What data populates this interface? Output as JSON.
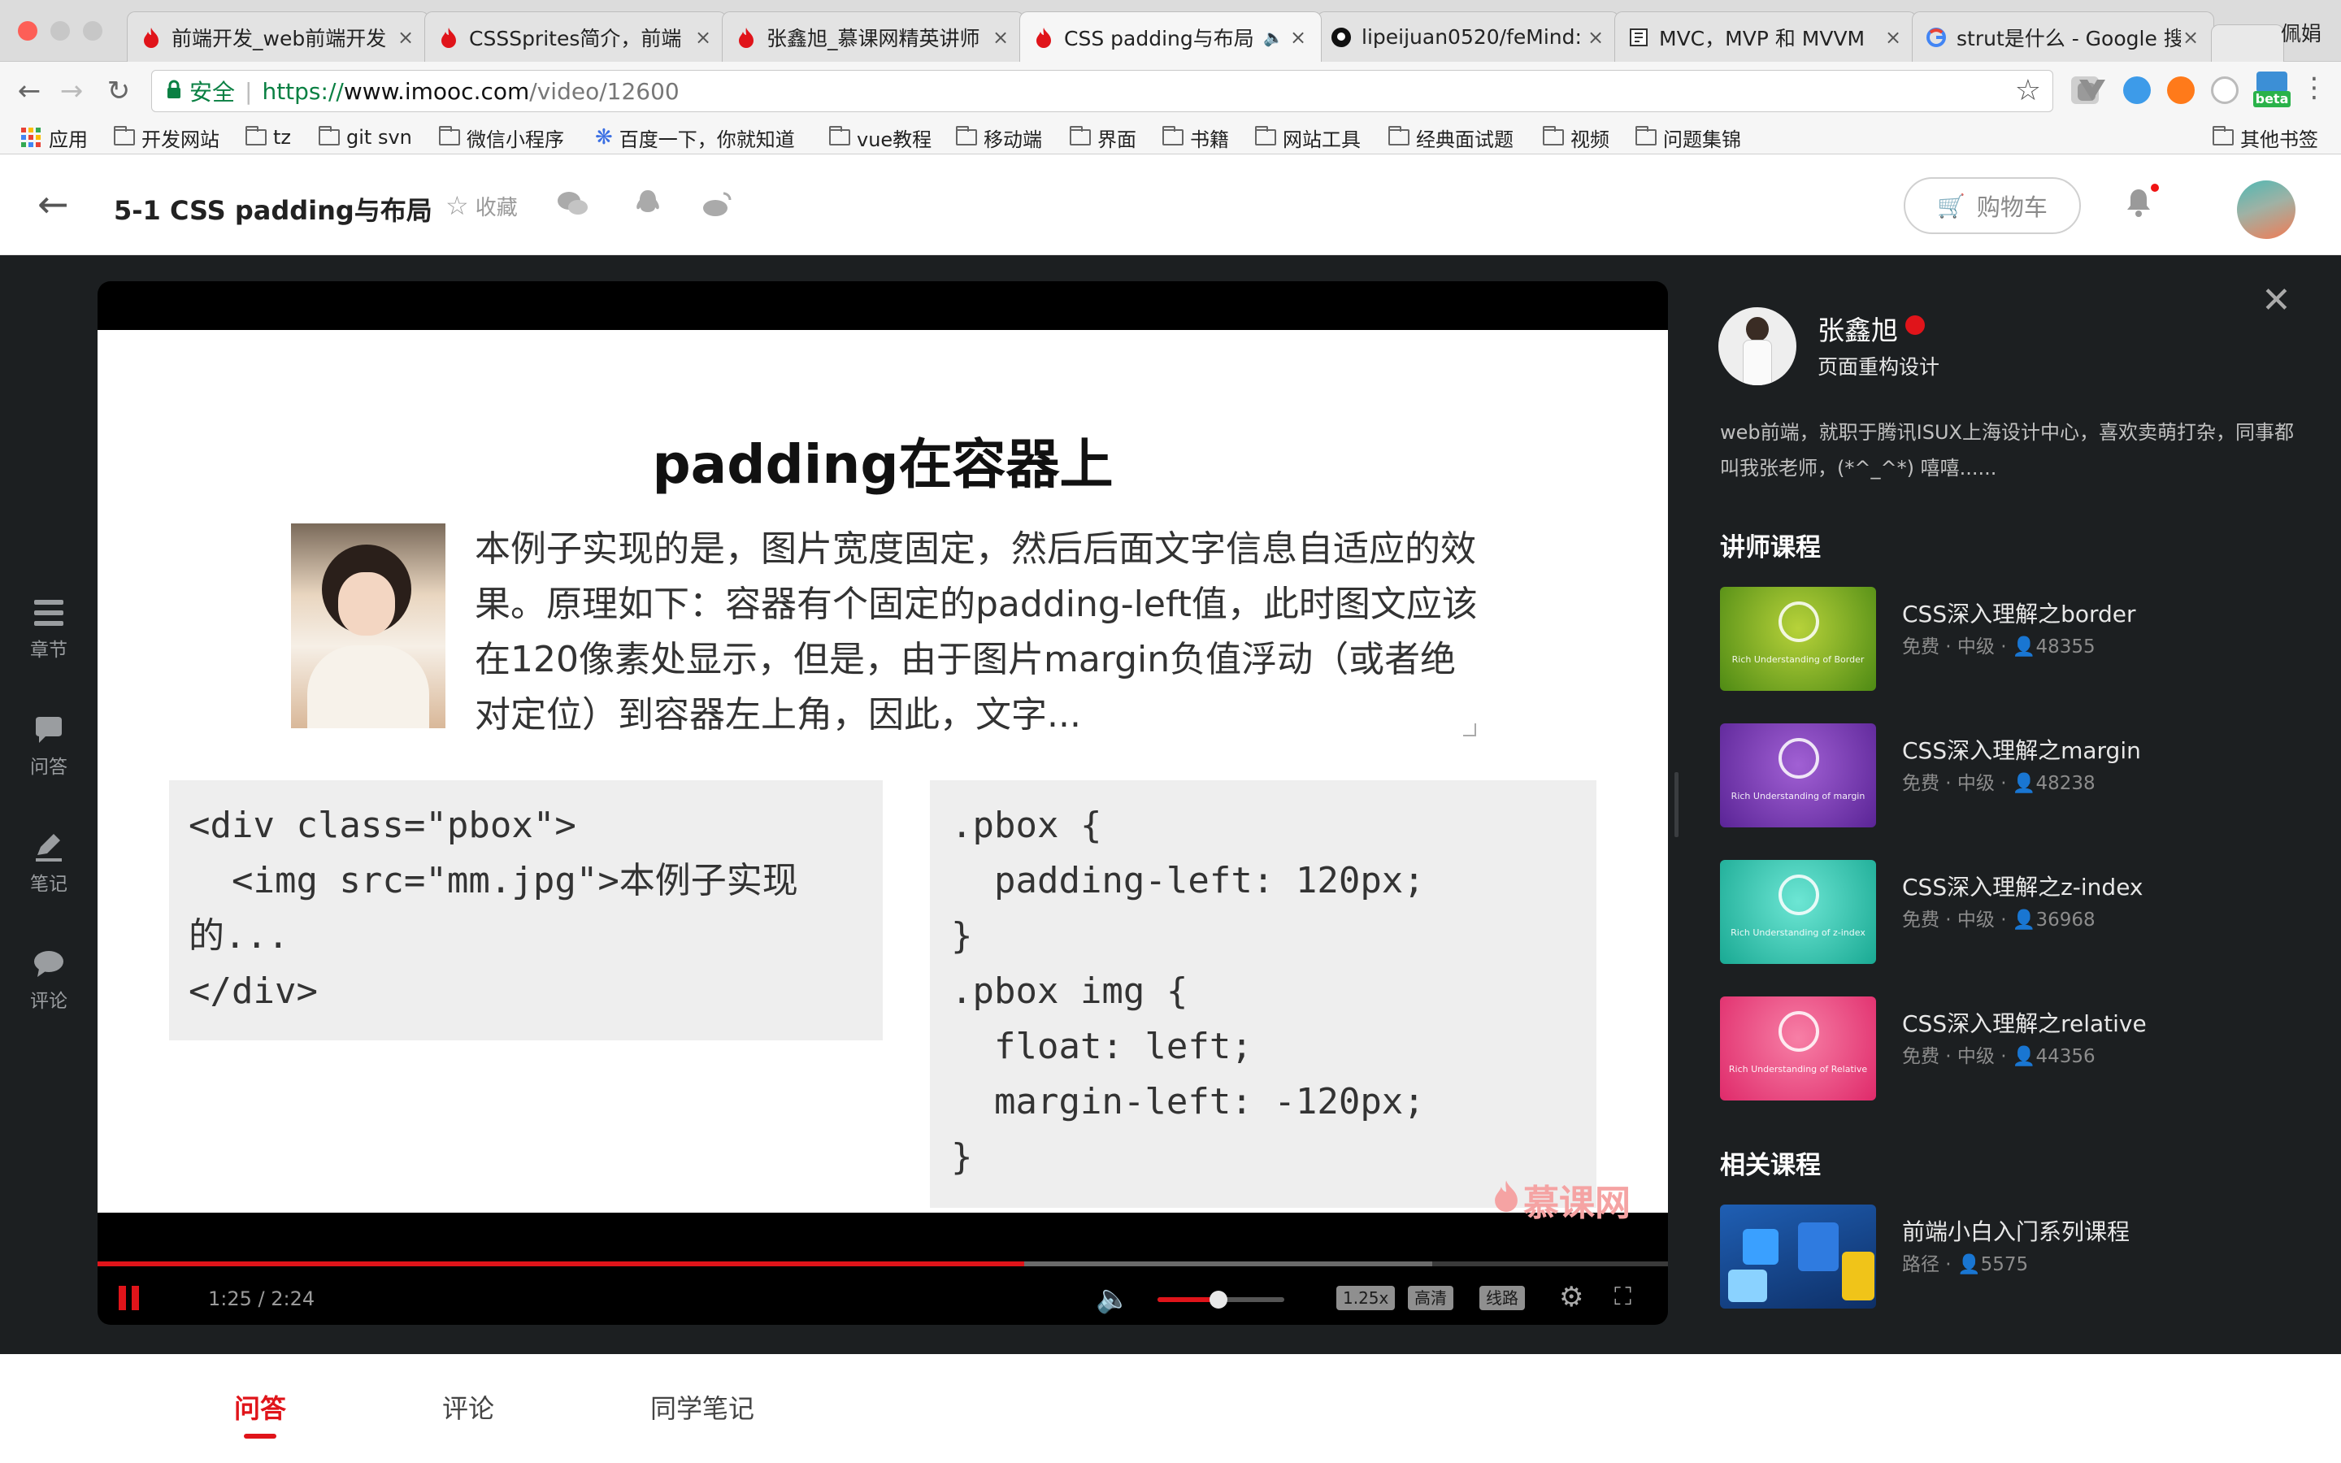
{
  "browser": {
    "tabs": [
      {
        "title": "前端开发_web前端开发",
        "icon": "imooc-flame-icon"
      },
      {
        "title": "CSSSprites简介，前端",
        "icon": "imooc-flame-icon"
      },
      {
        "title": "张鑫旭_慕课网精英讲师",
        "icon": "imooc-flame-icon"
      },
      {
        "title": "CSS padding与布局",
        "icon": "imooc-flame-icon",
        "active": true
      },
      {
        "title": "lipeijuan0520/feMind:",
        "icon": "github-icon"
      },
      {
        "title": "MVC，MVP 和 MVVM",
        "icon": "site-icon"
      },
      {
        "title": "strut是什么 - Google 搜",
        "icon": "google-icon"
      }
    ],
    "profile_name": "佩娟",
    "address": {
      "secure_label": "安全",
      "scheme": "https://",
      "host": "www.imooc.com",
      "path": "/video/12600"
    },
    "extension_badge": "beta",
    "bookmarks": [
      {
        "label": "应用",
        "icon": "apps-grid-icon"
      },
      {
        "label": "开发网站",
        "icon": "folder-icon"
      },
      {
        "label": "tz",
        "icon": "folder-icon"
      },
      {
        "label": "git svn",
        "icon": "folder-icon"
      },
      {
        "label": "微信小程序",
        "icon": "folder-icon"
      },
      {
        "label": "百度一下，你就知道",
        "icon": "baidu-paw-icon"
      },
      {
        "label": "vue教程",
        "icon": "folder-icon"
      },
      {
        "label": "移动端",
        "icon": "folder-icon"
      },
      {
        "label": "界面",
        "icon": "folder-icon"
      },
      {
        "label": "书籍",
        "icon": "folder-icon"
      },
      {
        "label": "网站工具",
        "icon": "folder-icon"
      },
      {
        "label": "经典面试题",
        "icon": "folder-icon"
      },
      {
        "label": "视频",
        "icon": "folder-icon"
      },
      {
        "label": "问题集锦",
        "icon": "folder-icon"
      }
    ],
    "other_bookmarks": "其他书签"
  },
  "header": {
    "title": "5-1 CSS padding与布局",
    "favorite_label": "收藏",
    "cart_label": "购物车"
  },
  "sidenav": [
    {
      "label": "章节",
      "icon": "chapters-icon"
    },
    {
      "label": "问答",
      "icon": "qa-icon"
    },
    {
      "label": "笔记",
      "icon": "notes-pen-icon"
    },
    {
      "label": "评论",
      "icon": "comment-bubble-icon"
    }
  ],
  "slide": {
    "title": "padding在容器上",
    "text": "本例子实现的是，图片宽度固定，然后后面文字信息自适应的效果。原理如下：容器有个固定的padding-left值，此时图文应该在120像素处显示，但是，由于图片margin负值浮动（或者绝对定位）到容器左上角，因此，文字...",
    "html_code": "<div class=\"pbox\">\n  <img src=\"mm.jpg\">本例子实现\n的...\n</div>",
    "css_code": ".pbox {\n  padding-left: 120px;\n}\n.pbox img {\n  float: left;\n  margin-left: -120px;\n}",
    "watermark": "慕课网"
  },
  "player": {
    "time": "1:25 / 2:24",
    "progress_fraction": 0.59,
    "buffered_fraction": 0.85,
    "volume_fraction": 0.48,
    "speed": "1.25x",
    "quality": "高清",
    "route": "线路"
  },
  "teacher": {
    "name": "张鑫旭",
    "role": "页面重构设计",
    "bio": "web前端，就职于腾讯ISUX上海设计中心，喜欢卖萌打杂，同事都叫我张老师，(*^_^*) 嘻嘻......"
  },
  "teacher_courses_heading": "讲师课程",
  "teacher_courses": [
    {
      "title": "CSS深入理解之border",
      "meta": "免费 · 中级 · ",
      "count": "48355",
      "thumb_caption": "Rich Understanding of Border",
      "color_a": "#b7d23a",
      "color_b": "#4e8a14"
    },
    {
      "title": "CSS深入理解之margin",
      "meta": "免费 · 中级 · ",
      "count": "48238",
      "thumb_caption": "Rich Understanding of margin",
      "color_a": "#a160d4",
      "color_b": "#5a2496"
    },
    {
      "title": "CSS深入理解之z-index",
      "meta": "免费 · 中级 · ",
      "count": "36968",
      "thumb_caption": "Rich Understanding of z-index",
      "color_a": "#6de6d4",
      "color_b": "#19a993"
    },
    {
      "title": "CSS深入理解之relative",
      "meta": "免费 · 中级 · ",
      "count": "44356",
      "thumb_caption": "Rich Understanding of Relative",
      "color_a": "#f77fa6",
      "color_b": "#df2a6a"
    }
  ],
  "related_heading": "相关课程",
  "related_courses": [
    {
      "title": "前端小白入门系列课程",
      "meta": "路径 · ",
      "count": "5575",
      "color_a": "#1f5fb4",
      "color_b": "#0e2f66"
    }
  ],
  "bottom_tabs": [
    {
      "label": "问答",
      "active": true
    },
    {
      "label": "评论"
    },
    {
      "label": "同学笔记"
    }
  ],
  "colors": {
    "accent": "#e0141a",
    "player_bg": "#1c1f21",
    "secure_green": "#0a8043"
  }
}
